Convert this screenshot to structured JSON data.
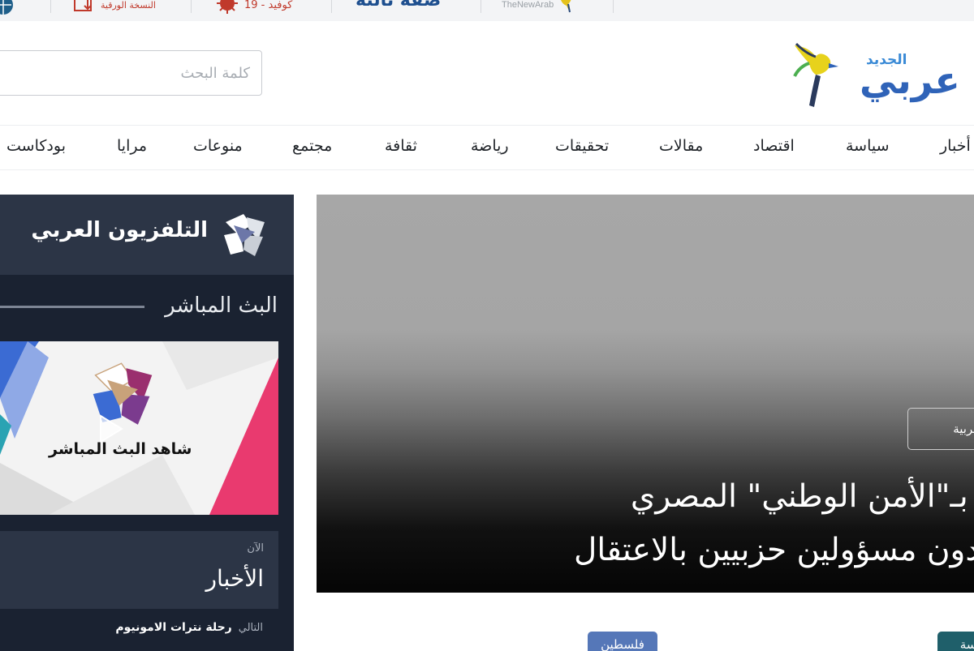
{
  "topbar": {
    "newarab": "TheNewArab",
    "third_page": "ضفة ثالثة",
    "covid": "كوفيد - 19",
    "paper_edition": "النسخة الورقية"
  },
  "search": {
    "placeholder": "كلمة البحث"
  },
  "logo": {
    "word": "عربي",
    "sub": "الجديد"
  },
  "nav": {
    "items": [
      "أخبار",
      "سياسة",
      "اقتصاد",
      "مقالات",
      "تحقيقات",
      "رياضة",
      "ثقافة",
      "مجتمع",
      "منوعات",
      "مرايا",
      "بودكاست"
    ]
  },
  "hero": {
    "tag": "تقارير عربية",
    "title_line1": "ضباط بـ\"الأمن الوطني\" المصري",
    "title_line2": "يهددون مسؤولين حزبيين بالاعتقال"
  },
  "tv": {
    "brand": "التلفزيون العربي",
    "live_label": "البث المباشر",
    "live_card_text": "شاهد البث المباشر",
    "now_label": "الآن",
    "now_title": "الأخبار",
    "next_label": "التالي",
    "next_title": "رحلة نترات الامونيوم"
  },
  "tags": {
    "blue": "فلسطين",
    "teal": "سياسة"
  },
  "colors": {
    "brand_blue": "#2f63b8",
    "tv_bg": "#1a2231",
    "tv_head": "#2c3546",
    "tag_blue": "#5577b8",
    "tag_teal": "#1f5f6a",
    "live_pink": "#e83e6c"
  }
}
